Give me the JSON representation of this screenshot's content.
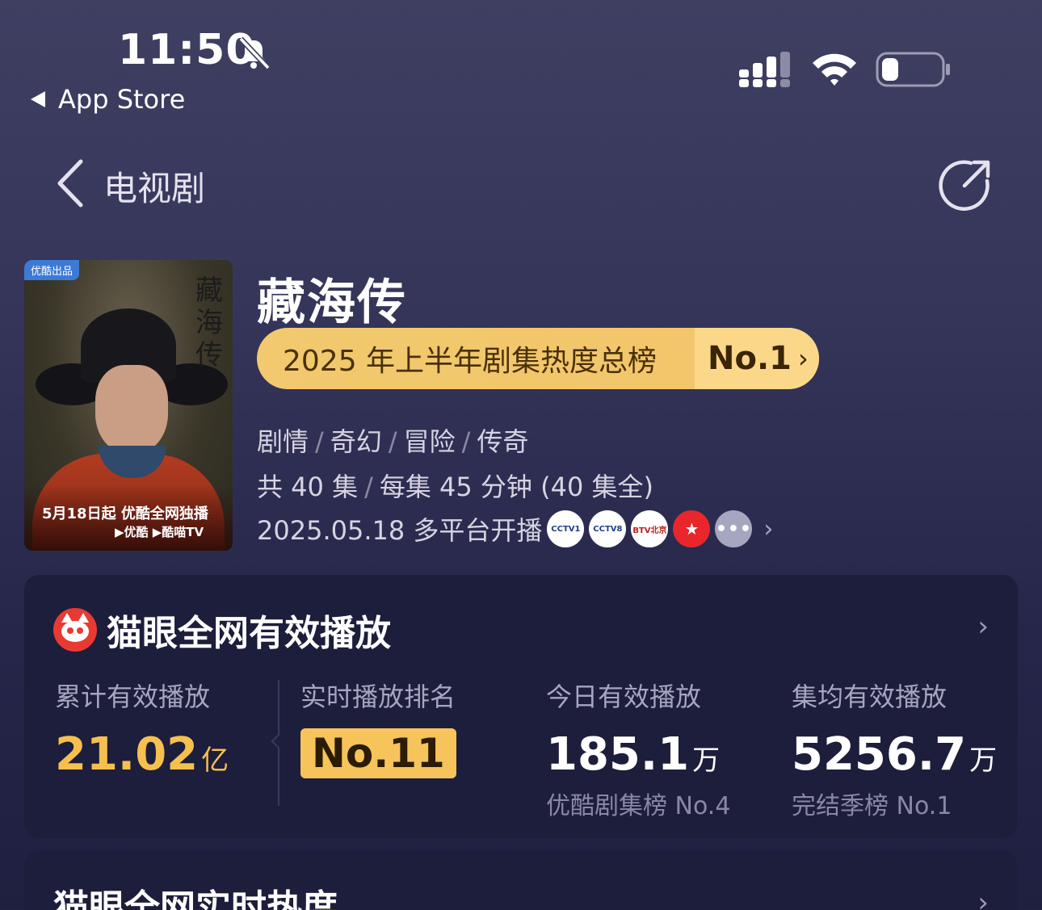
{
  "status_bar": {
    "time": "11:50",
    "back_app": "App Store",
    "icons": [
      "bell-slash-icon",
      "signal-icon",
      "wifi-icon",
      "battery-icon"
    ],
    "battery_level": 0.15
  },
  "nav": {
    "back_icon": "chevron-left-icon",
    "title": "电视剧",
    "share_icon": "share-icon"
  },
  "poster": {
    "badge": "优酷出品",
    "calligraphy": "藏海传",
    "line1": "5月18日起 优酷全网独播",
    "line2": "▶优酷 ▶酷喵TV"
  },
  "drama": {
    "title": "藏海传",
    "rank_label": "2025 年上半年剧集热度总榜",
    "rank_value": "No.1",
    "rank_chevron": "›",
    "genres": [
      "剧情",
      "奇幻",
      "冒险",
      "传奇"
    ],
    "episodes": "共 40 集",
    "duration": "每集 45 分钟 (40 集全)",
    "release": "2025.05.18 多平台开播",
    "platform_logos": [
      {
        "name": "cctv1-logo",
        "text": "CCTV1"
      },
      {
        "name": "cctv8-logo",
        "text": "CCTV8"
      },
      {
        "name": "btv-logo",
        "text": "BTV北京"
      },
      {
        "name": "dragon-tv-logo",
        "text": ""
      },
      {
        "name": "more-logo",
        "text": "•••"
      }
    ]
  },
  "maoyan": {
    "title": "猫眼全网有效播放",
    "stats": {
      "total_label": "累计有效播放",
      "total_value": "21.02",
      "total_unit": "亿",
      "rank_label": "实时播放排名",
      "rank_value": "No.11",
      "today_label": "今日有效播放",
      "today_value": "185.1",
      "today_unit": "万",
      "today_sub": "优酷剧集榜 No.4",
      "avg_label": "集均有效播放",
      "avg_value": "5256.7",
      "avg_unit": "万",
      "avg_sub": "完结季榜 No.1"
    }
  },
  "heat": {
    "title": "猫眼全网实时热度"
  },
  "colors": {
    "accent_gold": "#f5c04e",
    "pill_gold": "#f2c96e",
    "card_bg": "#1d1d3c",
    "maoyan_red": "#e83a32"
  }
}
